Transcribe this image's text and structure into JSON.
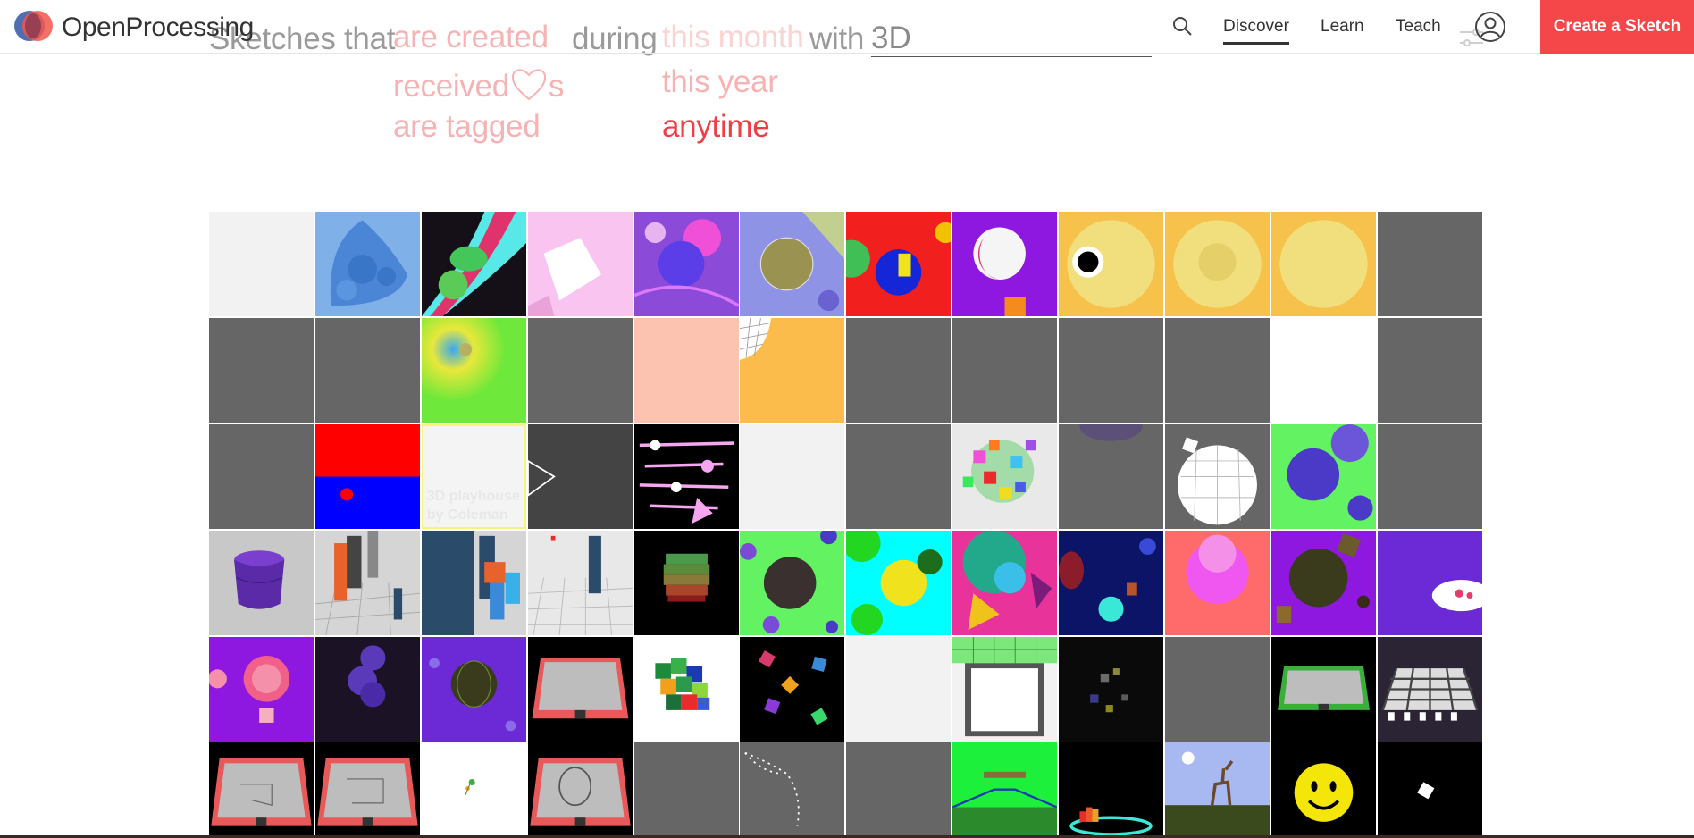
{
  "header": {
    "brand": "OpenProcessing",
    "nav": [
      {
        "label": "Discover",
        "active": true
      },
      {
        "label": "Learn",
        "active": false
      },
      {
        "label": "Teach",
        "active": false
      }
    ],
    "create_button": "Create a Sketch",
    "icons": [
      "logo",
      "search-icon",
      "user-icon",
      "sliders-icon"
    ]
  },
  "filter": {
    "prefix": "Sketches that",
    "action_options": [
      "are created",
      "received",
      "are tagged"
    ],
    "received_suffix": "s",
    "during_label": "during",
    "period_options": [
      "this month",
      "this year",
      "anytime"
    ],
    "selected_period": "anytime",
    "with_label": "with",
    "query": "3D"
  },
  "colors": {
    "accent": "#f5474a",
    "selected_filter": "#ef3e44",
    "unselected_filter": "#f7b3b3",
    "placeholder_tile": "#666666"
  },
  "hover_tile": {
    "title": "3D playhouse",
    "author": "by Coleman"
  }
}
